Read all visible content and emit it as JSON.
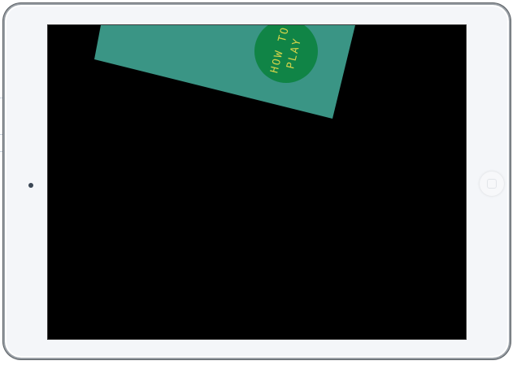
{
  "simulator": {
    "device": "iPad"
  },
  "game": {
    "how_to_play_line1": "HOW TO",
    "how_to_play_line2": "PLAY",
    "colors": {
      "panel": "#3a9585",
      "button": "#108446",
      "button_text": "#d4d44a",
      "screen_background": "#000000"
    }
  }
}
